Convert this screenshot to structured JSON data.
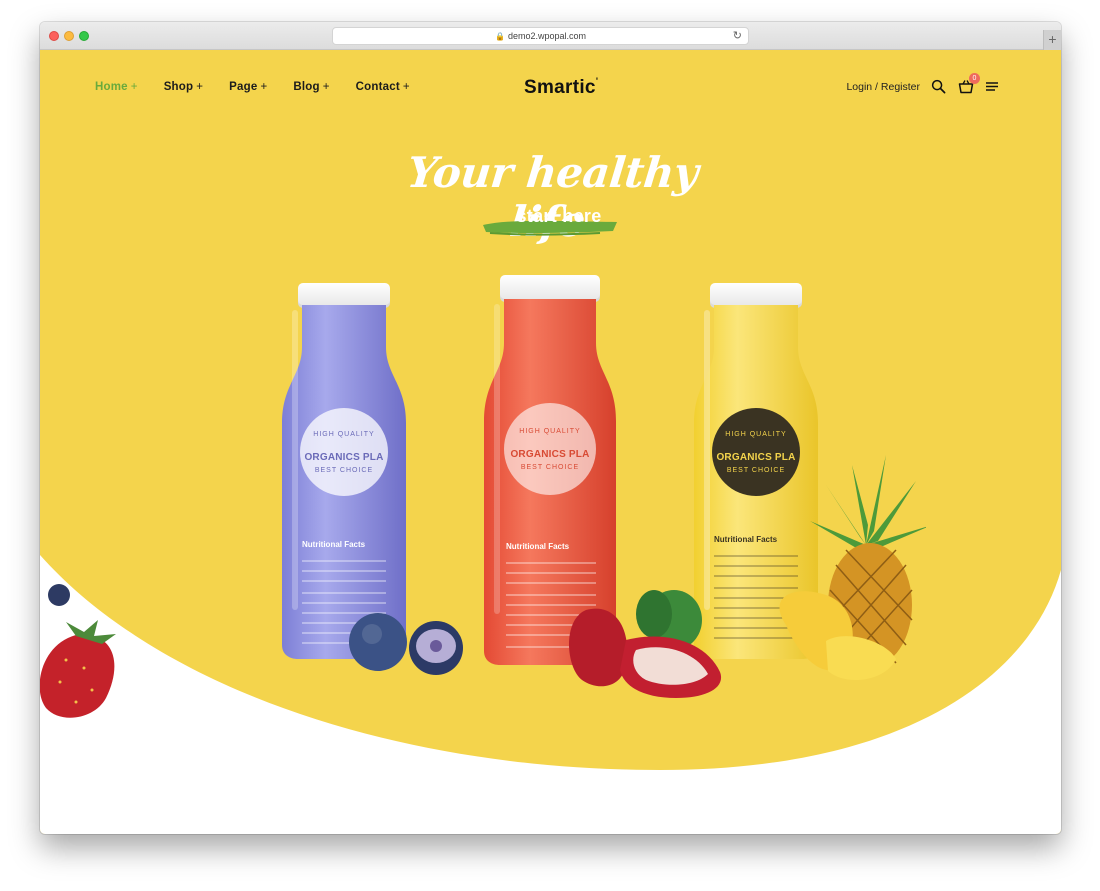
{
  "browser": {
    "url": "demo2.wpopal.com",
    "lock_icon": "lock-icon",
    "reload_icon": "reload-icon",
    "new_tab_label": "+"
  },
  "nav": {
    "items": [
      {
        "label": "Home",
        "suffix": "+",
        "active": true
      },
      {
        "label": "Shop",
        "suffix": "+",
        "active": false
      },
      {
        "label": "Page",
        "suffix": "+",
        "active": false
      },
      {
        "label": "Blog",
        "suffix": "+",
        "active": false
      },
      {
        "label": "Contact",
        "suffix": "+",
        "active": false
      }
    ]
  },
  "logo": {
    "text": "Smartic",
    "mark": "'"
  },
  "header_right": {
    "login_label": "Login / Register",
    "search_icon": "search-icon",
    "cart_icon": "cart-icon",
    "cart_count": "0",
    "menu_icon": "hamburger-menu-icon"
  },
  "hero": {
    "title": "Your healthy life",
    "subtitle": "start here"
  },
  "bottles": [
    {
      "color": "purple",
      "badge_top": "HIGH QUALITY",
      "badge_mid": "ORGANICS PLA",
      "badge_bot": "BEST CHOICE",
      "nutrition_title": "Nutritional Facts"
    },
    {
      "color": "red",
      "badge_top": "HIGH QUALITY",
      "badge_mid": "ORGANICS PLA",
      "badge_bot": "BEST CHOICE",
      "nutrition_title": "Nutritional Facts"
    },
    {
      "color": "yellow",
      "badge_top": "HIGH QUALITY",
      "badge_mid": "ORGANICS PLA",
      "badge_bot": "BEST CHOICE",
      "nutrition_title": "Nutritional Facts"
    }
  ],
  "colors": {
    "background_yellow": "#f4d44c",
    "accent_green": "#6aaa3c",
    "cart_badge": "#ef6b5c"
  }
}
